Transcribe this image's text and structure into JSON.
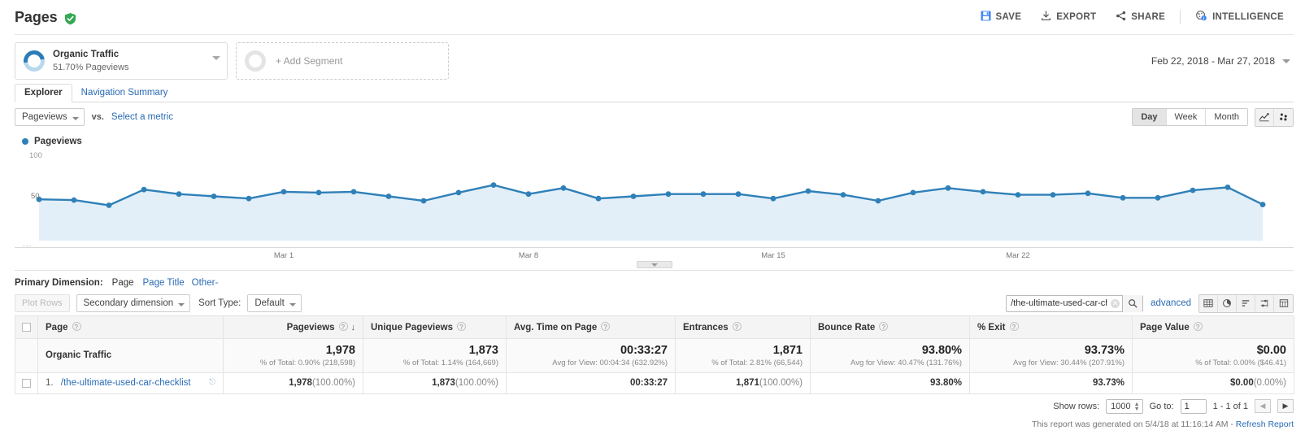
{
  "header": {
    "title": "Pages",
    "verified_icon": "shield-check-icon",
    "actions": [
      {
        "label": "SAVE",
        "icon": "save-icon"
      },
      {
        "label": "EXPORT",
        "icon": "export-icon"
      },
      {
        "label": "SHARE",
        "icon": "share-icon"
      },
      {
        "label": "INTELLIGENCE",
        "icon": "intelligence-icon"
      }
    ]
  },
  "segments": {
    "applied": {
      "name": "Organic Traffic",
      "sub": "51.70% Pageviews"
    },
    "add_label": "+ Add Segment",
    "date_range": "Feb 22, 2018 - Mar 27, 2018"
  },
  "tabs": [
    {
      "label": "Explorer",
      "active": true
    },
    {
      "label": "Navigation Summary",
      "active": false
    }
  ],
  "metric_row": {
    "metric": "Pageviews",
    "vs": "vs.",
    "select_metric": "Select a metric",
    "granularity": [
      {
        "label": "Day",
        "active": true
      },
      {
        "label": "Week",
        "active": false
      },
      {
        "label": "Month",
        "active": false
      }
    ],
    "chart_type_icons": [
      "line-chart-icon",
      "scatter-plot-icon"
    ]
  },
  "chart_data": {
    "type": "line",
    "title": "Pageviews",
    "legend": [
      "Pageviews"
    ],
    "legend_position": "top-left",
    "xlabel": "",
    "ylabel": "",
    "ylim": [
      0,
      100
    ],
    "y_ticks": [
      50,
      100
    ],
    "grid": false,
    "series_color": "#2f80b8",
    "fill_color": "#e3eff8",
    "x_tick_labels": [
      "Mar 1",
      "Mar 8",
      "Mar 15",
      "Mar 22"
    ],
    "x_tick_indices": [
      7,
      14,
      21,
      28
    ],
    "x": [
      "Feb 22",
      "Feb 23",
      "Feb 24",
      "Feb 25",
      "Feb 26",
      "Feb 27",
      "Feb 28",
      "Mar 1",
      "Mar 2",
      "Mar 3",
      "Mar 4",
      "Mar 5",
      "Mar 6",
      "Mar 7",
      "Mar 8",
      "Mar 9",
      "Mar 10",
      "Mar 11",
      "Mar 12",
      "Mar 13",
      "Mar 14",
      "Mar 15",
      "Mar 16",
      "Mar 17",
      "Mar 18",
      "Mar 19",
      "Mar 20",
      "Mar 21",
      "Mar 22",
      "Mar 23",
      "Mar 24",
      "Mar 25",
      "Mar 26",
      "Mar 27"
    ],
    "values": [
      51,
      50,
      43,
      64,
      58,
      55,
      52,
      61,
      60,
      61,
      55,
      49,
      60,
      70,
      58,
      66,
      52,
      55,
      58,
      58,
      58,
      52,
      62,
      57,
      49,
      60,
      66,
      61,
      57,
      57,
      59,
      53,
      53,
      63,
      67,
      44
    ],
    "series": [
      {
        "name": "Pageviews",
        "values": [
          51,
          50,
          43,
          64,
          58,
          55,
          52,
          61,
          60,
          61,
          55,
          49,
          60,
          70,
          58,
          66,
          52,
          55,
          58,
          58,
          58,
          52,
          62,
          57,
          49,
          60,
          66,
          61,
          57,
          57,
          59,
          53,
          53,
          63,
          67,
          44
        ]
      }
    ],
    "scroll_hint": "..."
  },
  "primary_dimension": {
    "label": "Primary Dimension:",
    "current": "Page",
    "links": [
      "Page Title",
      "Other"
    ],
    "other_caret": "-"
  },
  "table_toolbar": {
    "plot_rows": "Plot Rows",
    "secondary_dimension": "Secondary dimension",
    "sort_type_label": "Sort Type:",
    "sort_type_value": "Default",
    "search_value": "/the-ultimate-used-car-ch",
    "search_placeholder": "",
    "advanced": "advanced",
    "view_icons": [
      "table-view-icon",
      "pie-view-icon",
      "bar-view-icon",
      "comparison-view-icon",
      "pivot-view-icon"
    ]
  },
  "table": {
    "columns": [
      {
        "key": "page",
        "label": "Page",
        "numeric": false,
        "sorted": false
      },
      {
        "key": "pageviews",
        "label": "Pageviews",
        "numeric": true,
        "sorted": true
      },
      {
        "key": "unique_pageviews",
        "label": "Unique Pageviews",
        "numeric": true,
        "sorted": false
      },
      {
        "key": "avg_time",
        "label": "Avg. Time on Page",
        "numeric": true,
        "sorted": false
      },
      {
        "key": "entrances",
        "label": "Entrances",
        "numeric": true,
        "sorted": false
      },
      {
        "key": "bounce_rate",
        "label": "Bounce Rate",
        "numeric": true,
        "sorted": false
      },
      {
        "key": "pct_exit",
        "label": "% Exit",
        "numeric": true,
        "sorted": false
      },
      {
        "key": "page_value",
        "label": "Page Value",
        "numeric": true,
        "sorted": false
      }
    ],
    "summary": {
      "name": "Organic Traffic",
      "cells": [
        {
          "value": "1,978",
          "note": "% of Total: 0.90% (218,598)"
        },
        {
          "value": "1,873",
          "note": "% of Total: 1.14% (164,669)"
        },
        {
          "value": "00:33:27",
          "note": "Avg for View: 00:04:34 (632.92%)"
        },
        {
          "value": "1,871",
          "note": "% of Total: 2.81% (66,544)"
        },
        {
          "value": "93.80%",
          "note": "Avg for View: 40.47% (131.76%)"
        },
        {
          "value": "93.73%",
          "note": "Avg for View: 30.44% (207.91%)"
        },
        {
          "value": "$0.00",
          "note": "% of Total: 0.00% ($46.41)"
        }
      ]
    },
    "rows": [
      {
        "index": "1.",
        "page": "/the-ultimate-used-car-checklist",
        "cells": [
          {
            "value": "1,978",
            "pct": "(100.00%)"
          },
          {
            "value": "1,873",
            "pct": "(100.00%)"
          },
          {
            "value": "00:33:27",
            "pct": ""
          },
          {
            "value": "1,871",
            "pct": "(100.00%)"
          },
          {
            "value": "93.80%",
            "pct": ""
          },
          {
            "value": "93.73%",
            "pct": ""
          },
          {
            "value": "$0.00",
            "pct": "(0.00%)"
          }
        ]
      }
    ]
  },
  "footer": {
    "show_rows_label": "Show rows:",
    "show_rows_value": "1000",
    "goto_label": "Go to:",
    "goto_value": "1",
    "range_text": "1 - 1 of 1",
    "generated_note": "This report was generated on 5/4/18 at 11:16:14 AM - ",
    "refresh_link": "Refresh Report"
  },
  "colors": {
    "accent": "#2a6bb5",
    "chart_line": "#2f80b8",
    "chart_fill": "#e3eff8",
    "verified_green": "#34a853"
  }
}
